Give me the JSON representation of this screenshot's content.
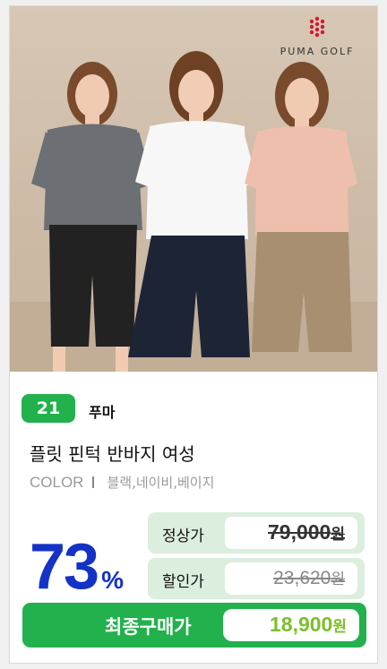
{
  "product": {
    "rank": "21",
    "brand": "푸마",
    "brand_logo_text": "PUMA GOLF",
    "title": "플릿 핀턱 반바지 여성",
    "color_label": "COLOR",
    "colors": "블랙,네이비,베이지",
    "discount_value": "73",
    "discount_unit": "%",
    "regular_label": "정상가",
    "regular_price": "79,000",
    "sale_label": "할인가",
    "sale_price": "23,620",
    "final_label": "최종구매가",
    "final_price": "18,900",
    "currency": "원"
  },
  "colors_theme": {
    "accent_green": "#22b14c",
    "discount_blue": "#1532c7",
    "final_price_green": "#7bbf2c",
    "price_box_bg": "#dceede"
  },
  "icons": {
    "logo": "puma-golf-hexagon-logo"
  }
}
